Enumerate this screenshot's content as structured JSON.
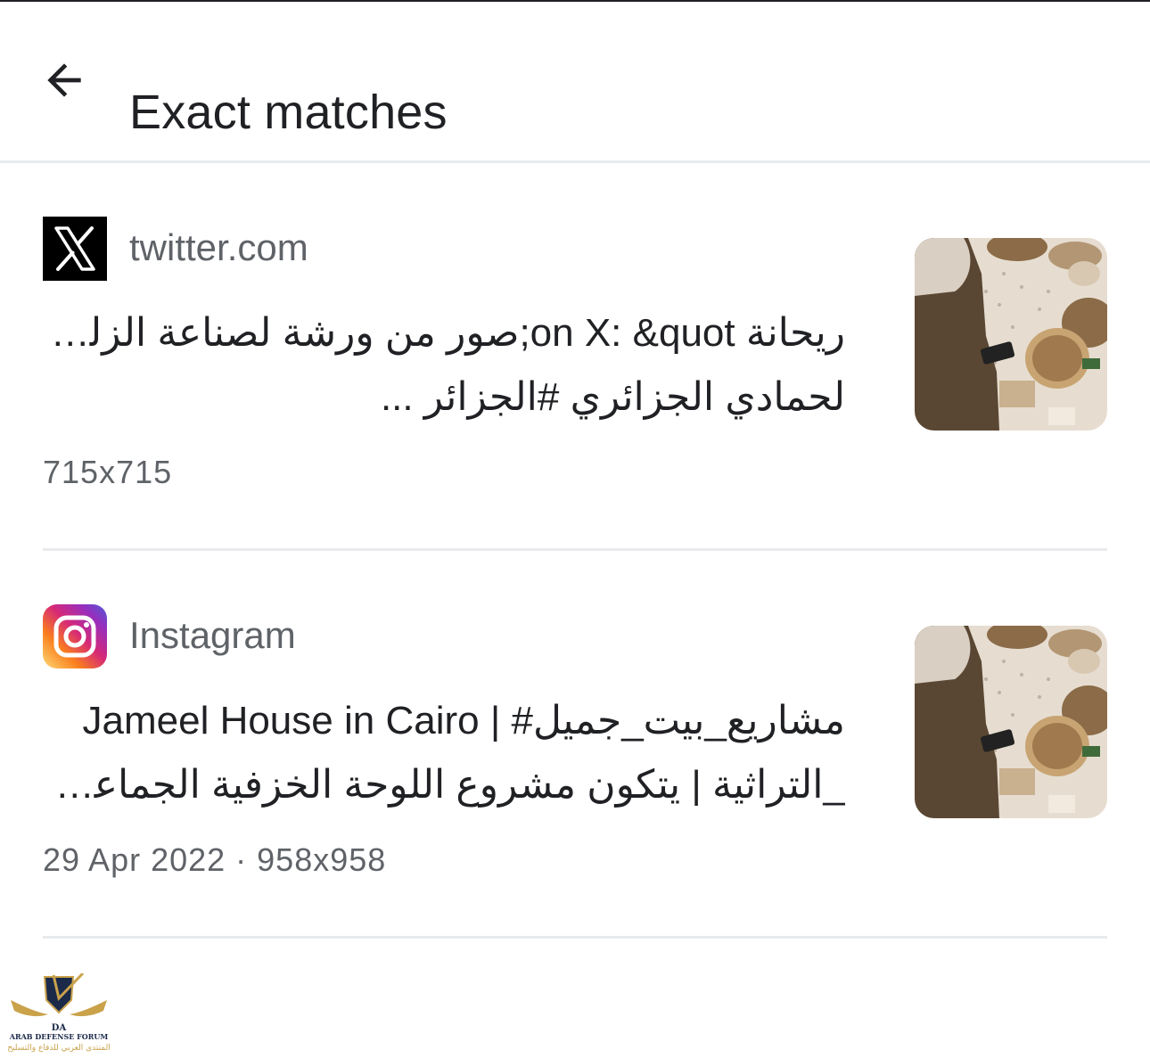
{
  "header": {
    "title": "Exact matches",
    "back_icon": "arrow-back-icon"
  },
  "results": [
    {
      "source": "twitter.com",
      "source_icon": "x-logo-icon",
      "title_lines": [
        "ريحانة on X: &quot;صور من ورشة لصناعة الزليج ا",
        "لحمادي الجزائري #الجزائر ..."
      ],
      "meta": "715x715",
      "thumbnail": "workshop-photo"
    },
    {
      "source": "Instagram",
      "source_icon": "instagram-logo-icon",
      "title_lines": [
        "Jameel House in Cairo | #مشاريع_بيت_جميل",
        "_التراثية | يتكون مشروع اللوحة الخزفية الجماعي من..."
      ],
      "meta": "29 Apr 2022 · 958x958",
      "thumbnail": "workshop-photo"
    }
  ],
  "watermark": {
    "name": "ARAB DEFENSE FORUM",
    "monogram": "DA",
    "arabic": "المنتدى العربي للدفاع والتسليح"
  },
  "colors": {
    "primary_text": "#202124",
    "secondary_text": "#5f6368",
    "divider": "#e8eaed"
  }
}
